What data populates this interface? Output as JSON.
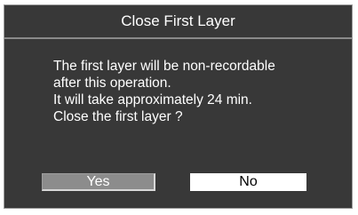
{
  "dialog": {
    "title": "Close First Layer",
    "message_lines": [
      "The first layer will be non-recordable",
      "after this operation.",
      "It will take approximately 24 min.",
      "Close the first layer ?"
    ],
    "buttons": {
      "yes_label": "Yes",
      "no_label": "No"
    }
  },
  "colors": {
    "dialog_background": "#383838",
    "title_text": "#ffffff",
    "yes_button_background": "#8c8c8c",
    "no_button_background": "#ffffff"
  }
}
